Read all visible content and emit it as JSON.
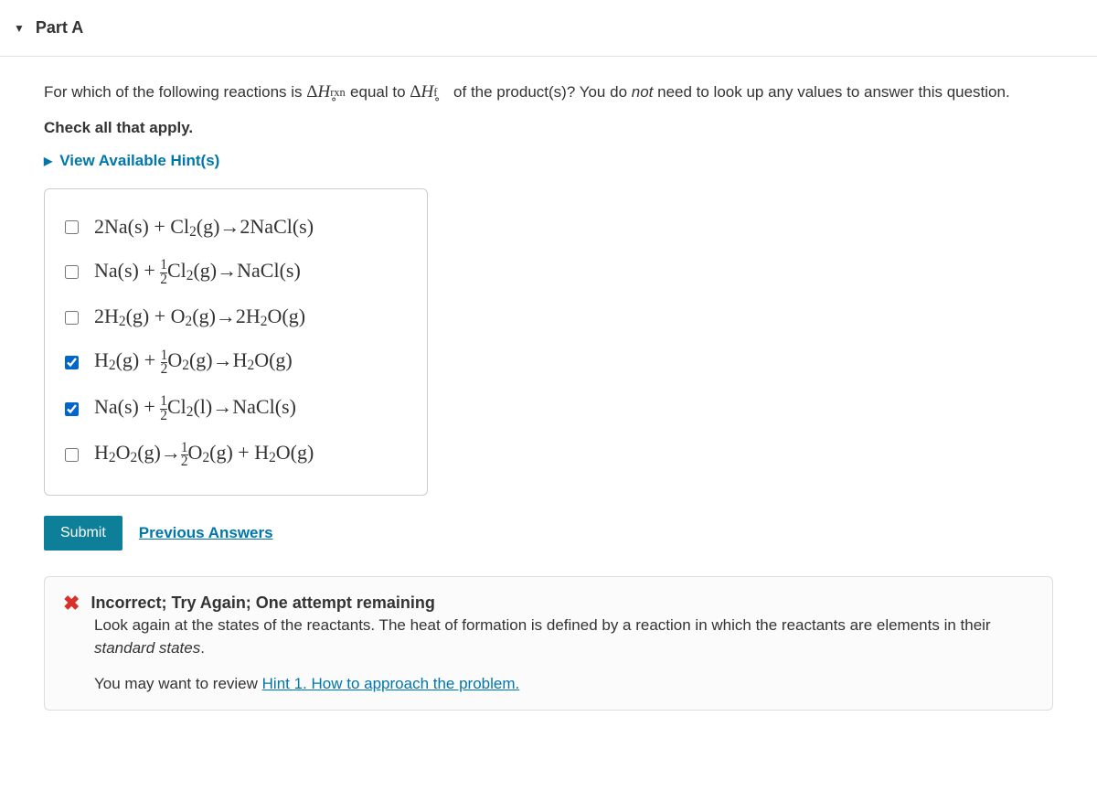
{
  "part": {
    "label": "Part A"
  },
  "question": {
    "prefix": "For which of the following reactions is ",
    "sym1_html": "Δ<em>H</em><span class='subsup'><span class='s-sup'>∘</span><span class='s-sub'>rxn</span></span>",
    "mid": " equal to ",
    "sym2_html": "Δ<em>H</em><span class='subsup'><span class='s-sup'>∘</span><span class='s-sub'>f</span></span>",
    "suffix_before_not": " of the product(s)? You do ",
    "not": "not",
    "suffix_after_not": " need to look up any values to answer this question."
  },
  "instruction": "Check all that apply.",
  "hints": {
    "toggle_label": "View Available Hint(s)"
  },
  "choices": [
    {
      "checked": false,
      "formula_html": "2Na(s) + Cl<sub>2</sub>(g)→2NaCl(s)"
    },
    {
      "checked": false,
      "formula_html": "Na(s) + <span class='frac'><span class='num'>1</span><span class='den'>2</span></span>Cl<sub>2</sub>(g)→NaCl(s)"
    },
    {
      "checked": false,
      "formula_html": "2H<sub>2</sub>(g) + O<sub>2</sub>(g)→2H<sub>2</sub>O(g)"
    },
    {
      "checked": true,
      "formula_html": "H<sub>2</sub>(g) + <span class='frac'><span class='num'>1</span><span class='den'>2</span></span>O<sub>2</sub>(g)→H<sub>2</sub>O(g)"
    },
    {
      "checked": true,
      "formula_html": "Na(s) + <span class='frac'><span class='num'>1</span><span class='den'>2</span></span>Cl<sub>2</sub>(l)→NaCl(s)"
    },
    {
      "checked": false,
      "formula_html": "H<sub>2</sub>O<sub>2</sub>(g)→<span class='frac'><span class='num'>1</span><span class='den'>2</span></span>O<sub>2</sub>(g) + H<sub>2</sub>O(g)"
    }
  ],
  "actions": {
    "submit": "Submit",
    "previous": "Previous Answers"
  },
  "feedback": {
    "title": "Incorrect; Try Again; One attempt remaining",
    "body_before_italic": "Look again at the states of the reactants. The heat of formation is defined by a reaction in which the reactants are elements in their ",
    "body_italic": "standard states",
    "body_after_italic": ".",
    "hint_prefix": "You may want to review ",
    "hint_link": "Hint 1. How to approach the problem."
  }
}
